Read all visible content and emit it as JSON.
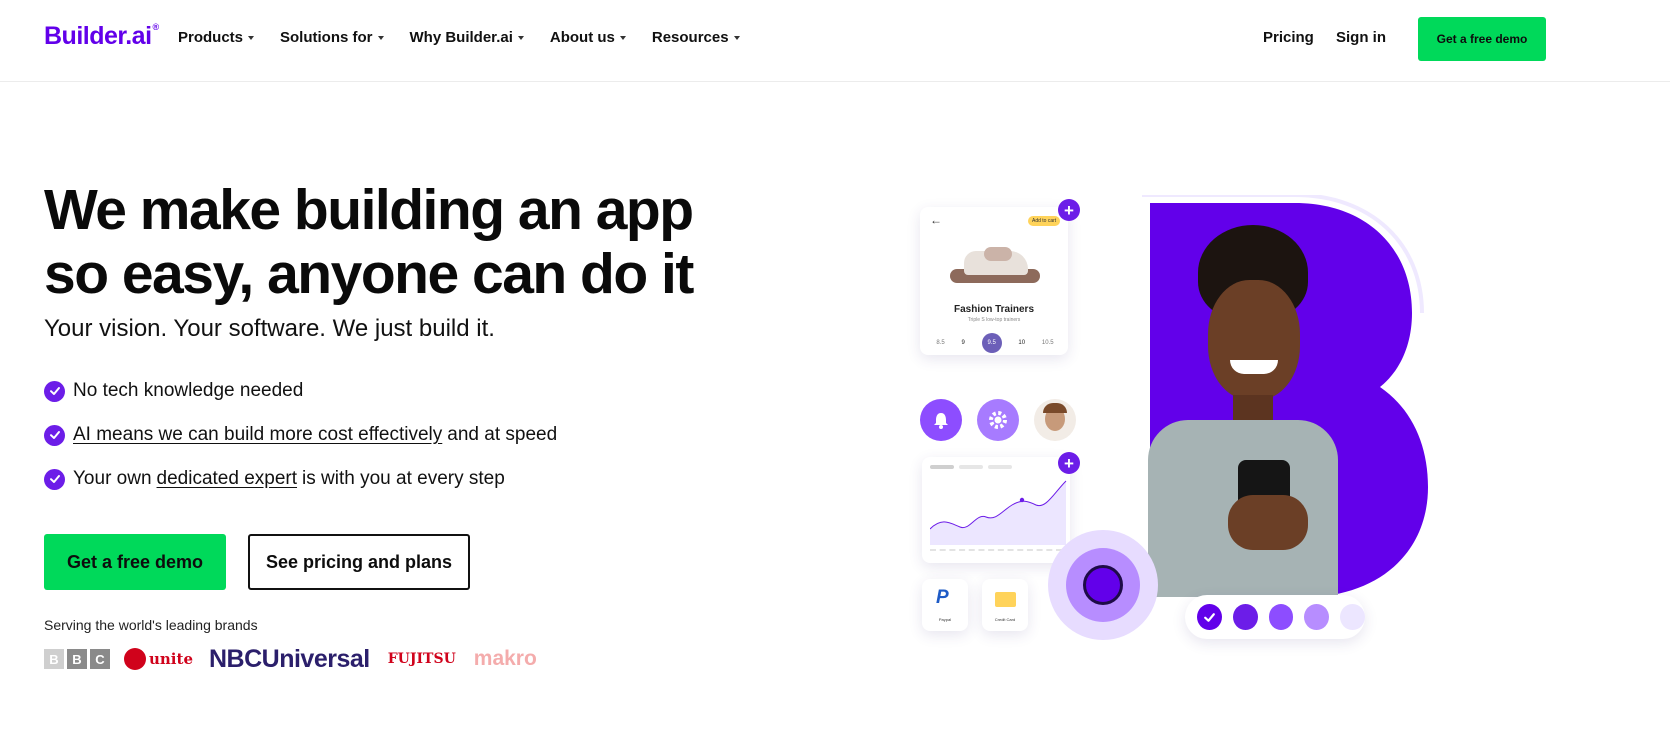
{
  "header": {
    "logo": "Builder.ai",
    "logo_mark": "®",
    "nav": [
      "Products",
      "Solutions for",
      "Why Builder.ai",
      "About us",
      "Resources"
    ],
    "pricing": "Pricing",
    "sign_in": "Sign in",
    "cta": "Get a free demo"
  },
  "hero": {
    "title": "We make building an app so easy, anyone can do it",
    "subtitle": "Your vision. Your software. We just build it.",
    "bullet1": "No tech knowledge needed",
    "bullet2_link": "AI means we can build more cost effectively",
    "bullet2_rest": "and at speed",
    "bullet3_pre": "Your own",
    "bullet3_link": "dedicated expert",
    "bullet3_rest": "is with you at every step",
    "cta_primary": "Get a free demo",
    "cta_secondary": "See pricing and plans",
    "serving": "Serving the world's leading brands"
  },
  "brands": {
    "bbc": [
      "B",
      "B",
      "C"
    ],
    "virgin": "unite",
    "nbc": "NBCUniversal",
    "fujitsu": "FUJITSU",
    "makro": "makro"
  },
  "illustration": {
    "add_to_cart": "Add to cart",
    "product_title": "Fashion Trainers",
    "product_sub": "Triple S low-top trainers",
    "sizes": [
      "8.5",
      "9",
      "9.5",
      "10",
      "10.5"
    ],
    "selected_size": "9.5",
    "paypal": "Paypal",
    "credit_card": "Credit Card"
  },
  "colors": {
    "brand_purple": "#6200ea",
    "accent_purple": "#6c1de8",
    "cta_green": "#00d95a"
  },
  "icons": [
    "check-icon",
    "caret-down-icon",
    "bell-icon",
    "gear-icon",
    "plus-icon",
    "back-arrow-icon",
    "paypal-icon",
    "credit-card-icon"
  ]
}
